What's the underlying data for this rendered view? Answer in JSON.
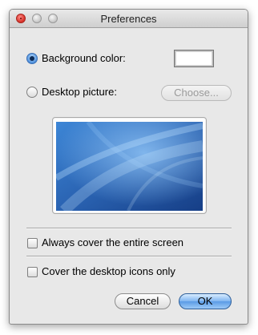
{
  "window": {
    "title": "Preferences"
  },
  "source": {
    "background_color": {
      "label": "Background color:",
      "selected": true,
      "color": "#ffffff"
    },
    "desktop_picture": {
      "label": "Desktop picture:",
      "selected": false,
      "choose_label": "Choose..."
    }
  },
  "options": {
    "cover_screen": {
      "label": "Always cover the entire screen",
      "checked": false
    },
    "cover_icons": {
      "label": "Cover the desktop icons only",
      "checked": false
    }
  },
  "buttons": {
    "cancel": "Cancel",
    "ok": "OK"
  },
  "colors": {
    "accent": "#5b9be6",
    "window_bg": "#e8e8e8"
  },
  "icons": {
    "close": "close-icon",
    "minimize": "minimize-icon",
    "zoom": "zoom-icon"
  }
}
